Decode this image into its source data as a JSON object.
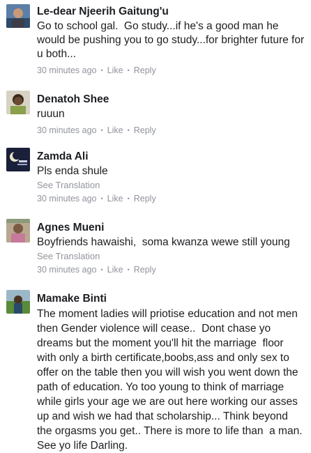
{
  "comments": [
    {
      "author": "Le-dear Njeerih Gaitung'u",
      "text": "Go to school gal.  Go study...if he's a good man he would be pushing you to go study...for brighter future for u both...",
      "time": "30 minutes ago",
      "like": "Like",
      "reply": "Reply",
      "dot": "•"
    },
    {
      "author": "Denatoh Shee",
      "text": "ruuun",
      "time": "30 minutes ago",
      "like": "Like",
      "reply": "Reply",
      "dot": "•"
    },
    {
      "author": "Zamda Ali",
      "text": "Pls enda shule",
      "translation": "See Translation",
      "time": "30 minutes ago",
      "like": "Like",
      "reply": "Reply",
      "dot": "•"
    },
    {
      "author": "Agnes Mueni",
      "text": "Boyfriends hawaishi,  soma kwanza wewe still young",
      "translation": "See Translation",
      "time": "30 minutes ago",
      "like": "Like",
      "reply": "Reply",
      "dot": "•"
    },
    {
      "author": "Mamake Binti",
      "text": "The moment ladies will priotise education and not men then Gender violence will cease..  Dont chase yo dreams but the moment you'll hit the marriage  floor with only a birth certificate,boobs,ass and only sex to offer on the table then you will wish you went down the path of education. Yo too young to think of marriage while girls your age we are out here working our asses up and wish we had that scholarship... Think beyond the orgasms you get.. There is more to life than  a man. See yo life Darling."
    }
  ]
}
